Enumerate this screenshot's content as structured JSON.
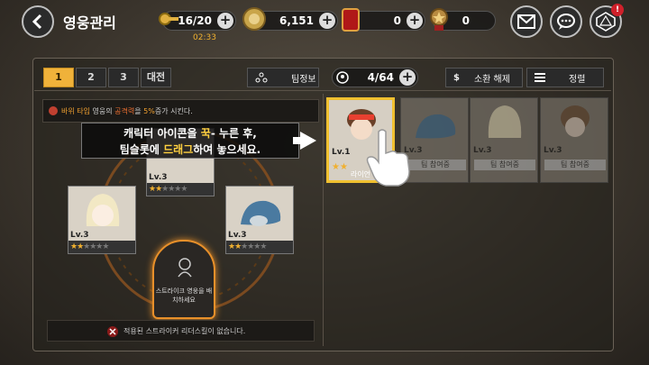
{
  "header": {
    "title": "영웅관리",
    "stamina": "16/20",
    "timer": "02:33",
    "coins": "6,151",
    "gems": "0",
    "medals": "0"
  },
  "tabs": [
    "1",
    "2",
    "3",
    "대전"
  ],
  "toolbar": {
    "team_info": "팀정보",
    "hero_count": "4/64",
    "summon_release": "소환 해제",
    "sort": "정렬"
  },
  "info_bar": {
    "prefix": "바위 타입",
    "mid1": " 영웅의 ",
    "stat": "공격력",
    "mid2": "을 ",
    "pct": "5%",
    "suffix": "증가 시킨다."
  },
  "team_slots": [
    {
      "level": "Lv.3",
      "stars_on": 2,
      "stars_total": 6
    },
    {
      "level": "Lv.3",
      "stars_on": 2,
      "stars_total": 6
    },
    {
      "level": "Lv.3",
      "stars_on": 2,
      "stars_total": 6
    }
  ],
  "strike_slot_text": "스트라이크 영웅을 배치하세요",
  "bottom_msg": "적용된 스트라이커 리더스킬이 없습니다.",
  "tooltip": {
    "l1a": "캐릭터 아이콘을 ",
    "l1b": "꾹",
    "l1c": "- 누른 후,",
    "l2a": "팀슬롯에 ",
    "l2b": "드래그",
    "l2c": "하여 놓으세요."
  },
  "heroes": [
    {
      "level": "Lv.1",
      "stars": "★★",
      "name": "라이언",
      "badge": ""
    },
    {
      "level": "Lv.3",
      "stars": "",
      "name": "",
      "badge": "팀 참여중"
    },
    {
      "level": "Lv.3",
      "stars": "",
      "name": "",
      "badge": "팀 참여중"
    },
    {
      "level": "Lv.3",
      "stars": "",
      "name": "",
      "badge": "팀 참여중"
    }
  ],
  "colors": {
    "accent": "#f0b23a",
    "glow": "#e8902a",
    "badge_red": "#d0202a"
  }
}
